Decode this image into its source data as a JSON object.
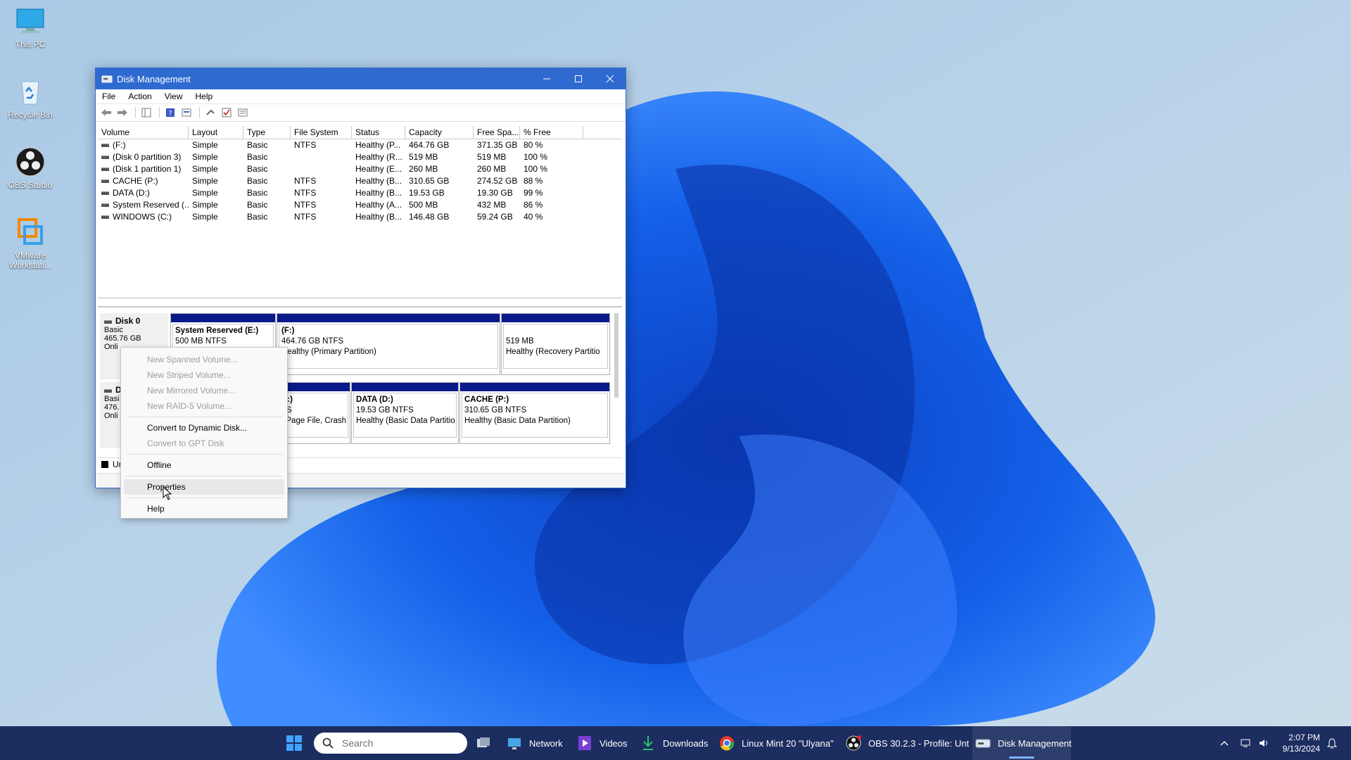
{
  "desktop": {
    "icons": [
      {
        "label": "This PC"
      },
      {
        "label": "Recycle Bin"
      },
      {
        "label": "OBS Studio"
      },
      {
        "label": "VMware Workstati..."
      }
    ]
  },
  "window": {
    "title": "Disk Management",
    "menu": [
      "File",
      "Action",
      "View",
      "Help"
    ],
    "columns": [
      "Volume",
      "Layout",
      "Type",
      "File System",
      "Status",
      "Capacity",
      "Free Spa...",
      "% Free"
    ],
    "volumes": [
      {
        "volume": "(F:)",
        "layout": "Simple",
        "type": "Basic",
        "fs": "NTFS",
        "status": "Healthy (P...",
        "capacity": "464.76 GB",
        "free": "371.35 GB",
        "pct": "80 %"
      },
      {
        "volume": "(Disk 0 partition 3)",
        "layout": "Simple",
        "type": "Basic",
        "fs": "",
        "status": "Healthy (R...",
        "capacity": "519 MB",
        "free": "519 MB",
        "pct": "100 %"
      },
      {
        "volume": "(Disk 1 partition 1)",
        "layout": "Simple",
        "type": "Basic",
        "fs": "",
        "status": "Healthy (E...",
        "capacity": "260 MB",
        "free": "260 MB",
        "pct": "100 %"
      },
      {
        "volume": "CACHE (P:)",
        "layout": "Simple",
        "type": "Basic",
        "fs": "NTFS",
        "status": "Healthy (B...",
        "capacity": "310.65 GB",
        "free": "274.52 GB",
        "pct": "88 %"
      },
      {
        "volume": "DATA (D:)",
        "layout": "Simple",
        "type": "Basic",
        "fs": "NTFS",
        "status": "Healthy (B...",
        "capacity": "19.53 GB",
        "free": "19.30 GB",
        "pct": "99 %"
      },
      {
        "volume": "System Reserved (...",
        "layout": "Simple",
        "type": "Basic",
        "fs": "NTFS",
        "status": "Healthy (A...",
        "capacity": "500 MB",
        "free": "432 MB",
        "pct": "86 %"
      },
      {
        "volume": "WINDOWS (C:)",
        "layout": "Simple",
        "type": "Basic",
        "fs": "NTFS",
        "status": "Healthy (B...",
        "capacity": "146.48 GB",
        "free": "59.24 GB",
        "pct": "40 %"
      }
    ],
    "disk0": {
      "name": "Disk 0",
      "type": "Basic",
      "size": "465.76 GB",
      "state": "Onli",
      "partitions": [
        {
          "title": "System Reserved  (E:)",
          "line2": "500 MB NTFS",
          "line3": ""
        },
        {
          "title": "(F:)",
          "line2": "464.76 GB NTFS",
          "line3": "Healthy (Primary Partition)"
        },
        {
          "title": "",
          "line2": "519 MB",
          "line3": "Healthy (Recovery Partitio"
        }
      ]
    },
    "disk1": {
      "name": "D",
      "type": "Basi",
      "size": "476.",
      "state": "Onli",
      "partitions": [
        {
          "title": "C:)",
          "line2": "FS",
          "line3": ", Page File, Crash D"
        },
        {
          "title": "DATA  (D:)",
          "line2": "19.53 GB NTFS",
          "line3": "Healthy (Basic Data Partitio"
        },
        {
          "title": "CACHE  (P:)",
          "line2": "310.65 GB NTFS",
          "line3": "Healthy (Basic Data Partition)"
        }
      ]
    },
    "legend": "Ur"
  },
  "context_menu": {
    "items": [
      {
        "label": "New Spanned Volume...",
        "enabled": false
      },
      {
        "label": "New Striped Volume...",
        "enabled": false
      },
      {
        "label": "New Mirrored Volume...",
        "enabled": false
      },
      {
        "label": "New RAID-5 Volume...",
        "enabled": false
      },
      {
        "label": "Convert to Dynamic Disk...",
        "enabled": true
      },
      {
        "label": "Convert to GPT Disk",
        "enabled": false
      },
      {
        "label": "Offline",
        "enabled": true
      },
      {
        "label": "Properties",
        "enabled": true
      },
      {
        "label": "Help",
        "enabled": true
      }
    ]
  },
  "taskbar": {
    "search_placeholder": "Search",
    "apps": [
      {
        "label": "Network"
      },
      {
        "label": "Videos"
      },
      {
        "label": "Downloads"
      },
      {
        "label": "Linux Mint 20 \"Ulyana\""
      },
      {
        "label": "OBS 30.2.3 - Profile: Unt"
      },
      {
        "label": "Disk Management"
      }
    ],
    "time": "2:07 PM",
    "date": "9/13/2024"
  },
  "colors": {
    "titlebar": "#2f6ad0",
    "partition_stripe": "#0a1a8a",
    "taskbar": "#1c2d60"
  }
}
